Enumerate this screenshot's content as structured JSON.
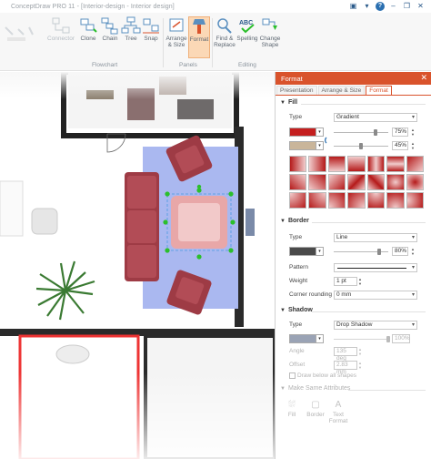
{
  "window": {
    "title": "ConceptDraw PRO 11 - [Interior-design - Interior design]"
  },
  "ribbon": {
    "buttons": [
      {
        "label": "Connector",
        "icon": "connector-icon"
      },
      {
        "label": "Clone",
        "icon": "clone-icon"
      },
      {
        "label": "Chain",
        "icon": "chain-icon"
      },
      {
        "label": "Tree",
        "icon": "tree-icon"
      },
      {
        "label": "Snap",
        "icon": "snap-icon"
      },
      {
        "label": "Arrange & Size",
        "icon": "arrange-size-icon"
      },
      {
        "label": "Format",
        "icon": "format-icon"
      },
      {
        "label": "Find & Replace",
        "icon": "find-replace-icon"
      },
      {
        "label": "Spelling",
        "icon": "spelling-icon"
      },
      {
        "label": "Change Shape",
        "icon": "change-shape-icon"
      }
    ],
    "groups": {
      "flowchart": "Flowchart",
      "panels": "Panels",
      "editing": "Editing"
    }
  },
  "panel": {
    "title": "Format",
    "tabs": [
      "Presentation",
      "Arrange & Size",
      "Format"
    ],
    "active_tab": "Format",
    "fill": {
      "heading": "Fill",
      "type_label": "Type",
      "type_value": "Gradient",
      "color1": "#c41f1f",
      "color1_pct": "75%",
      "color2": "#c9b59a",
      "color2_pct": "45%"
    },
    "border": {
      "heading": "Border",
      "type_label": "Type",
      "type_value": "Line",
      "color": "#4a4a4a",
      "color_pct": "80%",
      "pattern_label": "Pattern",
      "weight_label": "Weight",
      "weight_value": "1 pt",
      "corner_label": "Corner rounding",
      "corner_value": "0 mm"
    },
    "shadow": {
      "heading": "Shadow",
      "type_label": "Type",
      "type_value": "Drop Shadow",
      "color": "#9aa3b5",
      "color_pct": "100%",
      "angle_label": "Angle",
      "angle_value": "135 deg",
      "offset_label": "Offset",
      "offset_value": "2.83 mm",
      "draw_below": "Draw below all shapes"
    },
    "make_same": {
      "heading": "Make Same Attributes",
      "buttons": [
        "Fill",
        "Border",
        "Text Format"
      ]
    }
  },
  "colors": {
    "accent": "#d9532c",
    "rug": "#aab8f0",
    "sofa": "#a53b47",
    "selection": "#2bbf2b"
  }
}
